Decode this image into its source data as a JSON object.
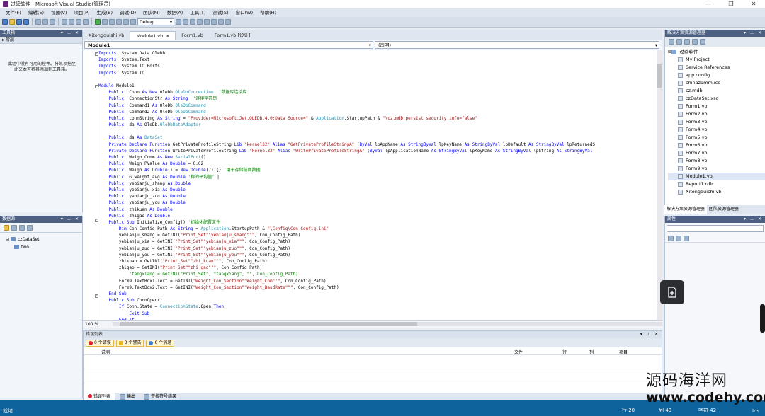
{
  "window": {
    "title": "过磅软件 - Microsoft Visual Studio(管理员)"
  },
  "menu": [
    "文件(F)",
    "编辑(E)",
    "视图(V)",
    "项目(P)",
    "生成(B)",
    "调试(D)",
    "团队(M)",
    "数据(A)",
    "工具(T)",
    "测试(S)",
    "窗口(W)",
    "帮助(H)"
  ],
  "toolbar": {
    "config": "Debug"
  },
  "toolbox": {
    "title": "工具箱",
    "group": "常规",
    "message": "此组中没有可用的控件。将某项拖至此文本可将其添加到工具箱。"
  },
  "datasources": {
    "title": "数据源",
    "tree": [
      "czDataSet",
      "two"
    ]
  },
  "doctabs": [
    "Xitongduishi.vb",
    "Module1.vb",
    "Form1.vb",
    "Form1.vb [设计]"
  ],
  "nav": {
    "left": "Module1",
    "right": "(声明)"
  },
  "code": [
    [
      [
        "kw",
        "Imports"
      ],
      [
        "",
        "  System.Data.OleDb"
      ]
    ],
    [
      [
        "kw",
        "Imports"
      ],
      [
        "",
        "  System.Text"
      ]
    ],
    [
      [
        "kw",
        "Imports"
      ],
      [
        "",
        "  System.IO.Ports"
      ]
    ],
    [
      [
        "kw",
        "Imports"
      ],
      [
        "",
        "  System.IO"
      ]
    ],
    [],
    [
      [
        "kw",
        "Module"
      ],
      [
        "",
        " Module1"
      ]
    ],
    [
      [
        "",
        "    "
      ],
      [
        "kw",
        "Public"
      ],
      [
        "",
        "  Conn "
      ],
      [
        "kw",
        "As New"
      ],
      [
        "",
        " OleDb."
      ],
      [
        "ty",
        "OleDbConnection"
      ],
      [
        "",
        ""
      ],
      [
        "cm",
        "  '数据库连接库"
      ]
    ],
    [
      [
        "",
        "    "
      ],
      [
        "kw",
        "Public"
      ],
      [
        "",
        "  ConnectionStr "
      ],
      [
        "kw",
        "As"
      ],
      [
        "",
        ""
      ],
      [
        "kw",
        " String"
      ],
      [
        "cm",
        "  '连接字符串"
      ]
    ],
    [
      [
        "",
        "    "
      ],
      [
        "kw",
        "Public"
      ],
      [
        "",
        "  Command1 "
      ],
      [
        "kw",
        "As"
      ],
      [
        "",
        " OleDb."
      ],
      [
        "ty",
        "OleDbCommand"
      ]
    ],
    [
      [
        "",
        "    "
      ],
      [
        "kw",
        "Public"
      ],
      [
        "",
        "  Command2 "
      ],
      [
        "kw",
        "As"
      ],
      [
        "",
        " OleDb."
      ],
      [
        "ty",
        "OleDbCommand"
      ]
    ],
    [
      [
        "",
        "    "
      ],
      [
        "kw",
        "Public"
      ],
      [
        "",
        "  connString "
      ],
      [
        "kw",
        "As String"
      ],
      [
        "",
        " = "
      ],
      [
        "st",
        "\"Provider=Microsoft.Jet.OLEDB.4.0;Data Source=\""
      ],
      [
        "",
        " & "
      ],
      [
        "ty",
        "Application"
      ],
      [
        "",
        ".StartupPath & "
      ],
      [
        "st",
        "\"\\cz.mdb;persist security info=false\""
      ]
    ],
    [
      [
        "",
        "    "
      ],
      [
        "kw",
        "Public"
      ],
      [
        "",
        "  da "
      ],
      [
        "kw",
        "As"
      ],
      [
        "",
        " OleDb."
      ],
      [
        "ty",
        "OleDbDataAdapter"
      ]
    ],
    [],
    [
      [
        "",
        "    "
      ],
      [
        "kw",
        "Public"
      ],
      [
        "",
        "  ds "
      ],
      [
        "kw",
        "As"
      ],
      [
        "",
        " "
      ],
      [
        "ty",
        "DataSet"
      ]
    ],
    [
      [
        "",
        "    "
      ],
      [
        "kw",
        "Private Declare Function"
      ],
      [
        "",
        " GetPrivateProfileString "
      ],
      [
        "kw",
        "Lib"
      ],
      [
        "",
        " "
      ],
      [
        "st",
        "\"kernel32\""
      ],
      [
        "",
        " "
      ],
      [
        "kw",
        "Alias"
      ],
      [
        "",
        " "
      ],
      [
        "st",
        "\"GetPrivateProfileStringA\""
      ],
      [
        "",
        " ("
      ],
      [
        "kw",
        "ByVal"
      ],
      [
        "",
        " lpAppName "
      ],
      [
        "kw",
        "As String"
      ],
      [
        ", "
      ],
      [
        "kw",
        "ByVal"
      ],
      [
        "",
        " lpKeyName "
      ],
      [
        "kw",
        "As String"
      ],
      [
        ", "
      ],
      [
        "kw",
        "ByVal"
      ],
      [
        "",
        " lpDefault "
      ],
      [
        "kw",
        "As String"
      ],
      [
        ", "
      ],
      [
        "kw",
        "ByVal"
      ],
      [
        "",
        " lpReturnedS"
      ]
    ],
    [
      [
        "",
        "    "
      ],
      [
        "kw",
        "Private Declare Function"
      ],
      [
        "",
        " WritePrivateProfileString "
      ],
      [
        "kw",
        "Lib"
      ],
      [
        "",
        " "
      ],
      [
        "st",
        "\"kernel32\""
      ],
      [
        "",
        " "
      ],
      [
        "kw",
        "Alias"
      ],
      [
        "",
        " "
      ],
      [
        "st",
        "\"WritePrivateProfileStringA\""
      ],
      [
        "",
        " ("
      ],
      [
        "kw",
        "ByVal"
      ],
      [
        "",
        " lpApplicationName "
      ],
      [
        "kw",
        "As String"
      ],
      [
        ", "
      ],
      [
        "kw",
        "ByVal"
      ],
      [
        "",
        " lpKeyName "
      ],
      [
        "kw",
        "As String"
      ],
      [
        ", "
      ],
      [
        "kw",
        "ByVal"
      ],
      [
        "",
        " lpString "
      ],
      [
        "kw",
        "As String"
      ],
      [
        ", "
      ],
      [
        "kw",
        "ByVal"
      ]
    ],
    [
      [
        "",
        "    "
      ],
      [
        "kw",
        "Public"
      ],
      [
        "",
        "  Weigh_Comm "
      ],
      [
        "kw",
        "As New"
      ],
      [
        "",
        " "
      ],
      [
        "ty",
        "SerialPort"
      ],
      [
        "",
        "()"
      ]
    ],
    [
      [
        "",
        "    "
      ],
      [
        "kw",
        "Public"
      ],
      [
        "",
        "  Weigh_PValue "
      ],
      [
        "kw",
        "As Double"
      ],
      [
        "",
        " = 0.02"
      ]
    ],
    [
      [
        "",
        "    "
      ],
      [
        "kw",
        "Public"
      ],
      [
        "",
        "  Weigh "
      ],
      [
        "kw",
        "As Double"
      ],
      [
        "",
        "() = "
      ],
      [
        "kw",
        "New Double"
      ],
      [
        "",
        "(7) {} "
      ],
      [
        "cm",
        "'用于存储前面数据"
      ]
    ],
    [
      [
        "",
        "    "
      ],
      [
        "kw",
        "Public"
      ],
      [
        "",
        "  G_weight_avg "
      ],
      [
        "kw",
        "As Double"
      ],
      [
        "cm",
        " '称的平均值'"
      ],
      [
        "",
        " |"
      ]
    ],
    [
      [
        "",
        "    "
      ],
      [
        "kw",
        "Public"
      ],
      [
        "",
        "  yebianju_shang "
      ],
      [
        "kw",
        "As Double"
      ]
    ],
    [
      [
        "",
        "    "
      ],
      [
        "kw",
        "Public"
      ],
      [
        "",
        "  yebianju_xia "
      ],
      [
        "kw",
        "As Double"
      ]
    ],
    [
      [
        "",
        "    "
      ],
      [
        "kw",
        "Public"
      ],
      [
        "",
        "  yebianju_zuo "
      ],
      [
        "kw",
        "As Double"
      ]
    ],
    [
      [
        "",
        "    "
      ],
      [
        "kw",
        "Public"
      ],
      [
        "",
        "  yebianju_you "
      ],
      [
        "kw",
        "As Double"
      ]
    ],
    [
      [
        "",
        "    "
      ],
      [
        "kw",
        "Public"
      ],
      [
        "",
        "  zhikuan "
      ],
      [
        "kw",
        "As Double"
      ]
    ],
    [
      [
        "",
        "    "
      ],
      [
        "kw",
        "Public"
      ],
      [
        "",
        "  zhigao "
      ],
      [
        "kw",
        "As Double"
      ]
    ],
    [
      [
        "",
        "    "
      ],
      [
        "kw",
        "Public Sub"
      ],
      [
        "",
        " Initialize_Config() "
      ],
      [
        "cm",
        "'初始化配置文件"
      ]
    ],
    [
      [
        "",
        "        "
      ],
      [
        "kw",
        "Dim"
      ],
      [
        "",
        " Con_Config_Path "
      ],
      [
        "kw",
        "As String"
      ],
      [
        "",
        " = "
      ],
      [
        "ty",
        "Application"
      ],
      [
        "",
        ".StartupPath & "
      ],
      [
        "st",
        "\"\\Config\\Con_Config.ini\""
      ]
    ],
    [
      [
        "",
        "        yebianju_shang = GetINI("
      ],
      [
        "st",
        "\"Print_Set\""
      ],
      [
        ", "
      ],
      [
        "st",
        "\"yebianju_shang\""
      ],
      [
        ", "
      ],
      [
        "st",
        "\"\""
      ],
      [
        "",
        ", Con_Config_Path)"
      ]
    ],
    [
      [
        "",
        "        yebianju_xia = GetINI("
      ],
      [
        "st",
        "\"Print_Set\""
      ],
      [
        ", "
      ],
      [
        "st",
        "\"yebianju_xia\""
      ],
      [
        ", "
      ],
      [
        "st",
        "\"\""
      ],
      [
        "",
        ", Con_Config_Path)"
      ]
    ],
    [
      [
        "",
        "        yebianju_zuo = GetINI("
      ],
      [
        "st",
        "\"Print_Set\""
      ],
      [
        ", "
      ],
      [
        "st",
        "\"yebianju_zuo\""
      ],
      [
        ", "
      ],
      [
        "st",
        "\"\""
      ],
      [
        "",
        ", Con_Config_Path)"
      ]
    ],
    [
      [
        "",
        "        yebianju_you = GetINI("
      ],
      [
        "st",
        "\"Print_Set\""
      ],
      [
        ", "
      ],
      [
        "st",
        "\"yebianju_you\""
      ],
      [
        ", "
      ],
      [
        "st",
        "\"\""
      ],
      [
        "",
        ", Con_Config_Path)"
      ]
    ],
    [
      [
        "",
        "        zhikuan = GetINI("
      ],
      [
        "st",
        "\"Print_Set\""
      ],
      [
        ", "
      ],
      [
        "st",
        "\"zhi_kuan\""
      ],
      [
        ", "
      ],
      [
        "st",
        "\"\""
      ],
      [
        "",
        ", Con_Config_Path)"
      ]
    ],
    [
      [
        "",
        "        zhigao = GetINI("
      ],
      [
        "st",
        "\"Print_Set\""
      ],
      [
        ", "
      ],
      [
        "st",
        "\"zhi_gao\""
      ],
      [
        ", "
      ],
      [
        "st",
        "\"\""
      ],
      [
        "",
        ", Con_Config_Path)"
      ]
    ],
    [
      [
        "",
        "            "
      ],
      [
        "cm",
        "'fangxiang = GetINI(\"Print_Set\", \"fangxiang\", \"\", Con_Config_Path)"
      ]
    ],
    [
      [
        "",
        "        Form9.TextBox1.Text = GetINI("
      ],
      [
        "st",
        "\"Weight_Con_Section\""
      ],
      [
        ", "
      ],
      [
        "st",
        "\"Weight_Com\""
      ],
      [
        ", "
      ],
      [
        "st",
        "\"\""
      ],
      [
        "",
        ", Con_Config_Path)"
      ]
    ],
    [
      [
        "",
        "        Form9.TextBox2.Text = GetINI("
      ],
      [
        "st",
        "\"Weight_Con_Section\""
      ],
      [
        ", "
      ],
      [
        "st",
        "\"Weight_BaudRate\""
      ],
      [
        ", "
      ],
      [
        "st",
        "\"\""
      ],
      [
        "",
        ", Con_Config_Path)"
      ]
    ],
    [
      [
        "",
        "    "
      ],
      [
        "kw",
        "End Sub"
      ]
    ],
    [
      [
        "",
        "    "
      ],
      [
        "kw",
        "Public Sub"
      ],
      [
        "",
        " ConnOpen()"
      ]
    ],
    [
      [
        "",
        "        "
      ],
      [
        "kw",
        "If"
      ],
      [
        "",
        " Conn.State = "
      ],
      [
        "ty",
        "ConnectionState"
      ],
      [
        "",
        ".Open "
      ],
      [
        "kw",
        "Then"
      ]
    ],
    [
      [
        "",
        "            "
      ],
      [
        "kw",
        "Exit Sub"
      ]
    ],
    [
      [
        "",
        "        "
      ],
      [
        "kw",
        "End If"
      ]
    ]
  ],
  "editor": {
    "zoom": "100 %"
  },
  "errorlist": {
    "title": "错误列表",
    "errors": "0 个错误",
    "warnings": "3 个警告",
    "messages": "0 个消息",
    "cols": [
      "说明",
      "文件",
      "行",
      "列",
      "项目"
    ]
  },
  "bottomtabs": [
    "错误列表",
    "输出",
    "查找符号结果"
  ],
  "solution": {
    "title": "解决方案资源管理器",
    "project": "过磅软件",
    "items": [
      "My Project",
      "Service References",
      "app.config",
      "chinaz9mm.ico",
      "cz.mdb",
      "czDataSet.xsd",
      "Form1.vb",
      "Form2.vb",
      "Form3.vb",
      "Form4.vb",
      "Form5.vb",
      "Form6.vb",
      "Form7.vb",
      "Form8.vb",
      "Form9.vb",
      "Module1.vb",
      "Report1.rdlc",
      "Xitongduishi.vb"
    ],
    "tabs": [
      "解决方案资源管理器",
      "团队资源管理器"
    ]
  },
  "properties": {
    "title": "属性"
  },
  "status": {
    "left": "就绪",
    "row": "行 20",
    "col": "列 40",
    "ch": "字符 42",
    "ins": "Ins"
  },
  "watermark": {
    "line1": "源码海洋网",
    "line2": "www.codehy.com"
  }
}
